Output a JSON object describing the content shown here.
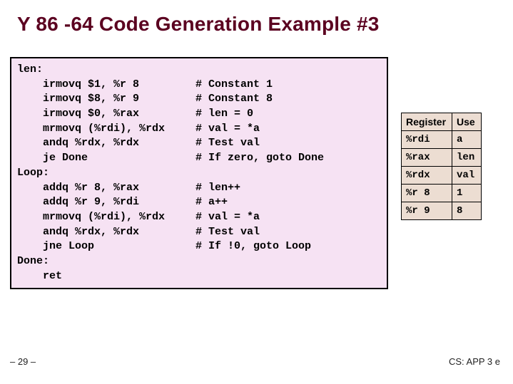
{
  "title": "Y 86 -64 Code Generation Example #3",
  "code": [
    {
      "left": "len:",
      "right": ""
    },
    {
      "left": "    irmovq $1, %r 8",
      "right": "# Constant 1"
    },
    {
      "left": "    irmovq $8, %r 9",
      "right": "# Constant 8"
    },
    {
      "left": "    irmovq $0, %rax",
      "right": "# len = 0"
    },
    {
      "left": "    mrmovq (%rdi), %rdx",
      "right": "# val = *a"
    },
    {
      "left": "    andq %rdx, %rdx",
      "right": "# Test val"
    },
    {
      "left": "    je Done",
      "right": "# If zero, goto Done"
    },
    {
      "left": "Loop:",
      "right": ""
    },
    {
      "left": "    addq %r 8, %rax",
      "right": "# len++"
    },
    {
      "left": "    addq %r 9, %rdi",
      "right": "# a++"
    },
    {
      "left": "    mrmovq (%rdi), %rdx",
      "right": "# val = *a"
    },
    {
      "left": "    andq %rdx, %rdx",
      "right": "# Test val"
    },
    {
      "left": "    jne Loop",
      "right": "# If !0, goto Loop"
    },
    {
      "left": "Done:",
      "right": ""
    },
    {
      "left": "    ret",
      "right": ""
    }
  ],
  "regtable": {
    "headers": {
      "reg": "Register",
      "use": "Use"
    },
    "rows": [
      {
        "reg": "%rdi",
        "use": "a"
      },
      {
        "reg": "%rax",
        "use": "len"
      },
      {
        "reg": "%rdx",
        "use": "val"
      },
      {
        "reg": "%r 8",
        "use": "1"
      },
      {
        "reg": "%r 9",
        "use": "8"
      }
    ]
  },
  "footer": {
    "left": "– 29 –",
    "right": "CS: APP 3 e"
  }
}
